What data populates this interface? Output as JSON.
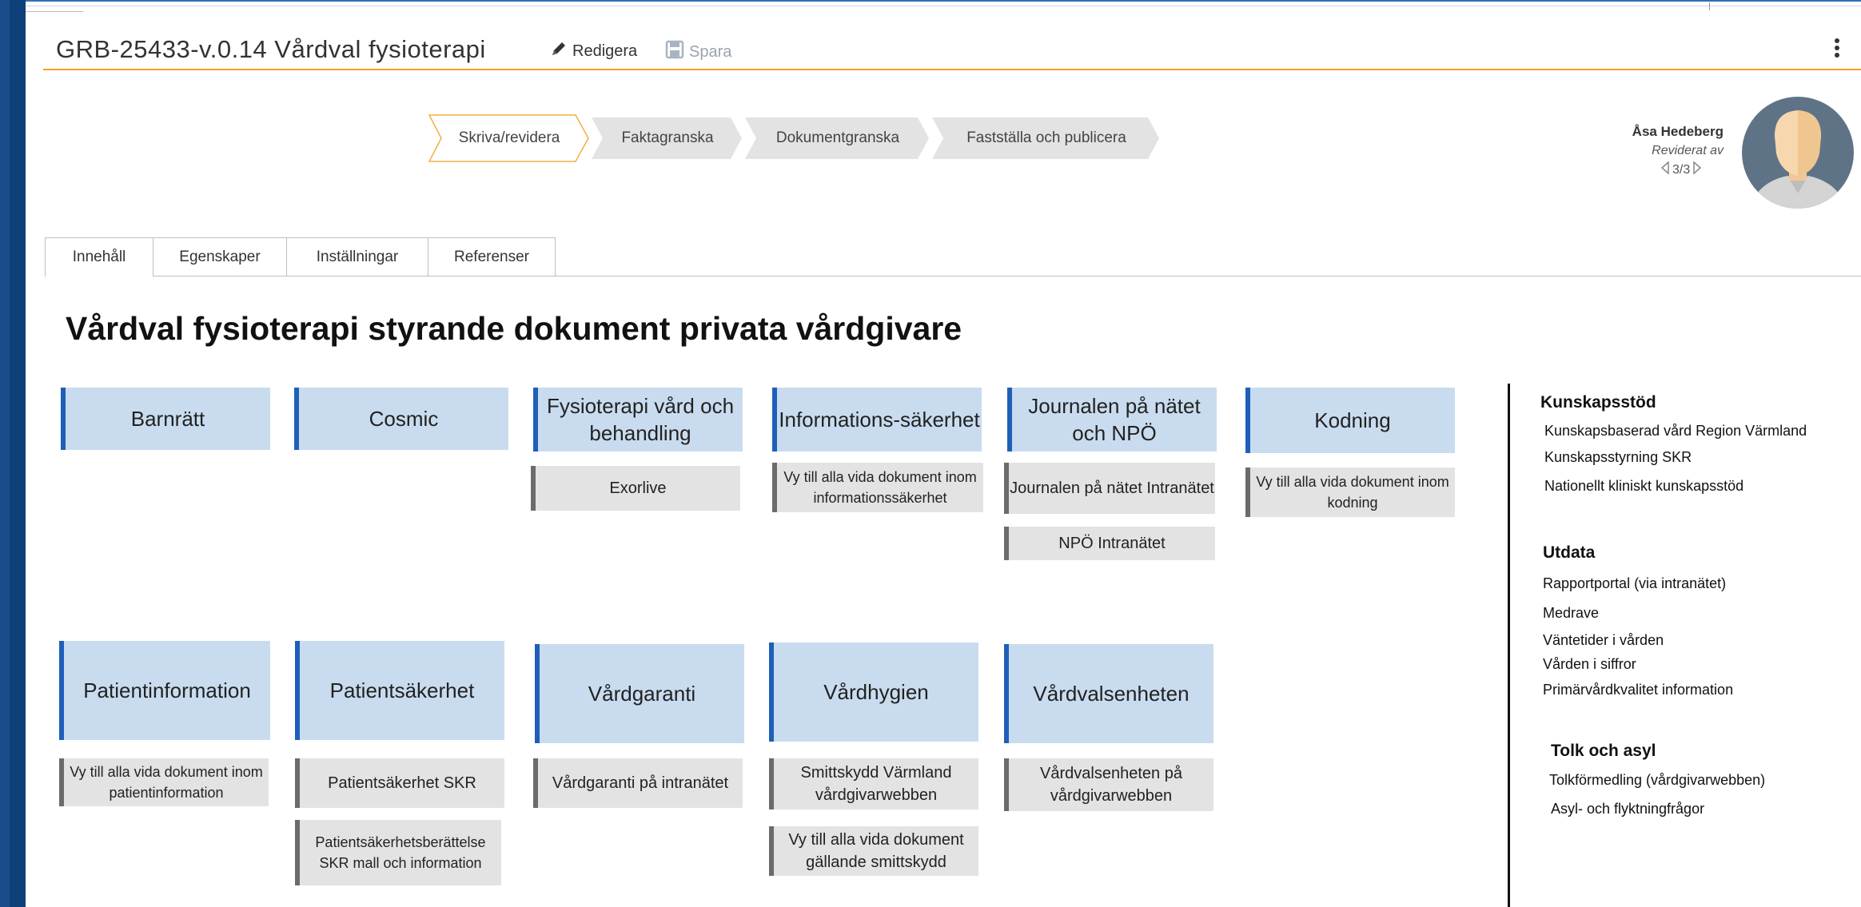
{
  "header": {
    "title": "GRB-25433-v.0.14 Vårdval fysioterapi",
    "edit_label": "Redigera",
    "save_label": "Spara"
  },
  "workflow": {
    "steps": [
      "Skriva/revidera",
      "Faktagranska",
      "Dokumentgranska",
      "Fastställa och publicera"
    ],
    "active_step": "Skriva/revidera"
  },
  "reviewer": {
    "name": "Åsa Hedeberg",
    "role": "Reviderat av",
    "pager": "3/3"
  },
  "tabs": [
    "Innehåll",
    "Egenskaper",
    "Inställningar",
    "Referenser"
  ],
  "active_tab": "Innehåll",
  "page_heading": "Vårdval fysioterapi styrande dokument privata vårdgivare",
  "categories": [
    {
      "title": "Barnrätt",
      "links": []
    },
    {
      "title": "Cosmic",
      "links": []
    },
    {
      "title": "Fysioterapi vård och behandling",
      "links": [
        "Exorlive"
      ]
    },
    {
      "title": "Informations-säkerhet",
      "links": [
        "Vy till alla vida dokument inom informationssäkerhet"
      ]
    },
    {
      "title": "Journalen på nätet och NPÖ",
      "links": [
        "Journalen på nätet Intranätet",
        "NPÖ Intranätet"
      ]
    },
    {
      "title": "Kodning",
      "links": [
        "Vy till alla vida dokument inom kodning"
      ]
    },
    {
      "title": "Patientinformation",
      "links": [
        "Vy till alla vida dokument inom patientinformation"
      ]
    },
    {
      "title": "Patientsäkerhet",
      "links": [
        "Patientsäkerhet SKR",
        "Patientsäkerhetsberättelse SKR mall och information"
      ]
    },
    {
      "title": "Vårdgaranti",
      "links": [
        "Vårdgaranti på intranätet"
      ]
    },
    {
      "title": "Vårdhygien",
      "links": [
        "Smittskydd Värmland vårdgivarwebben",
        "Vy till alla vida dokument gällande smittskydd"
      ]
    },
    {
      "title": "Vårdvalsenheten",
      "links": [
        "Vårdvalsenheten på vårdgivarwebben"
      ]
    }
  ],
  "sidebar": {
    "sections": [
      {
        "heading": "Kunskapsstöd",
        "items": [
          "Kunskapsbaserad vård Region Värmland",
          "Kunskapsstyrning SKR",
          "Nationellt kliniskt kunskapsstöd"
        ]
      },
      {
        "heading": "Utdata",
        "items": [
          "Rapportportal (via intranätet)",
          "Medrave",
          "Väntetider i vården",
          "Vården i siffror",
          "Primärvårdkvalitet information"
        ]
      },
      {
        "heading": "Tolk och asyl",
        "items": [
          "Tolkförmedling (vårdgivarwebben)",
          "Asyl- och flyktningfrågor"
        ]
      }
    ]
  },
  "colors": {
    "accent_orange": "#f0a030",
    "tile_blue": "#c9dcef",
    "tile_border_blue": "#1f5fb8",
    "link_grey": "#e3e3e3"
  },
  "icons": [
    "pencil-icon",
    "floppy-disk-icon",
    "kebab-menu-icon",
    "chevron-left-icon",
    "chevron-right-icon",
    "avatar-placeholder"
  ]
}
